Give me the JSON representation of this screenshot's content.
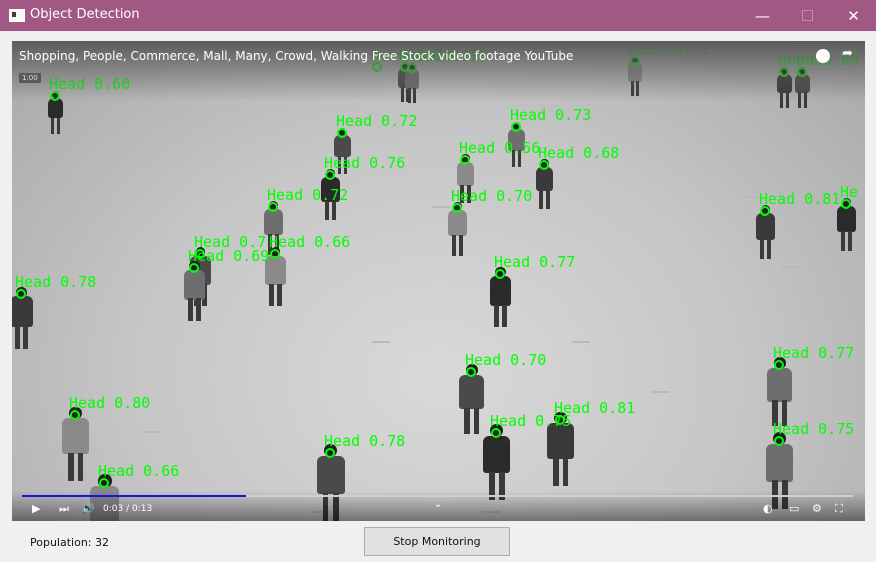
{
  "window": {
    "title": "Object Detection",
    "minimize": "—",
    "maximize": "☐",
    "close": "✕"
  },
  "video": {
    "title": "Shopping, People, Commerce, Mall, Many, Crowd, Walking Free Stock video footage YouTube",
    "badge": "1:00",
    "time": "0:03 / 0:13",
    "progress_fraction": 0.27,
    "controls": {
      "play": "▶",
      "next": "⏭",
      "volume": "🔊",
      "chevron": "⌄",
      "settings": "⚙",
      "fullscreen": "⛶",
      "subtitles": "▭",
      "autoplay": "◐"
    }
  },
  "detections": [
    {
      "label": "Head 0.78",
      "conf": 0.78
    },
    {
      "label": "Head 0.65",
      "conf": 0.65
    },
    {
      "label": "Head 0.70",
      "conf": 0.7
    },
    {
      "label": "Head 0.71",
      "conf": 0.71
    },
    {
      "label": "Head 0.59",
      "conf": 0.59
    },
    {
      "label": "Head 0.60",
      "conf": 0.6
    },
    {
      "label": "Head 0.72",
      "conf": 0.72
    },
    {
      "label": "Head 0.73",
      "conf": 0.73
    },
    {
      "label": "Head 0.56",
      "conf": 0.56
    },
    {
      "label": "Head 0.68",
      "conf": 0.68
    },
    {
      "label": "Head 0.76",
      "conf": 0.76
    },
    {
      "label": "Head 0",
      "conf": null
    },
    {
      "label": "Head 0.72",
      "conf": 0.72
    },
    {
      "label": "Head 0.70",
      "conf": 0.7
    },
    {
      "label": "Head 0.81",
      "conf": 0.81
    },
    {
      "label": "He",
      "conf": null
    },
    {
      "label": "Head 0.7",
      "conf": 0.7
    },
    {
      "label": "Head 0.69",
      "conf": 0.69
    },
    {
      "label": "Head 0.66",
      "conf": 0.66
    },
    {
      "label": "Head 0.78",
      "conf": 0.78
    },
    {
      "label": "Head 0.77",
      "conf": 0.77
    },
    {
      "label": "Head 0.70",
      "conf": 0.7
    },
    {
      "label": "Head 0.77",
      "conf": 0.77
    },
    {
      "label": "Head 0.80",
      "conf": 0.8
    },
    {
      "label": "Head 0.81",
      "conf": 0.81
    },
    {
      "label": "Head 0.75",
      "conf": 0.75
    },
    {
      "label": "Head 0.78",
      "conf": 0.78
    },
    {
      "label": "Head 0.75",
      "conf": 0.75
    },
    {
      "label": "Head 0.66",
      "conf": 0.66
    }
  ],
  "status": {
    "population_label": "Population: 32"
  },
  "buttons": {
    "stop_monitoring": "Stop Monitoring"
  }
}
